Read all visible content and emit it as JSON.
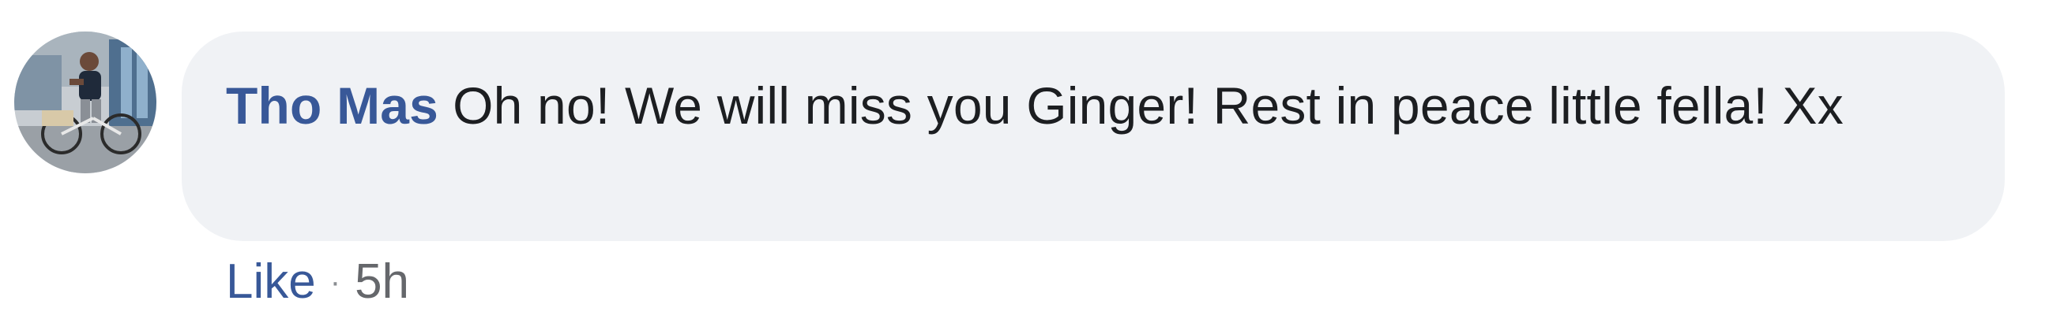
{
  "comment": {
    "author": "Tho Mas",
    "body": "Oh no! We will miss you Ginger! Rest in peace little fella! Xx",
    "like_label": "Like",
    "separator": "·",
    "timestamp": "5h"
  },
  "colors": {
    "bubble": "#f0f2f5",
    "author": "#385898",
    "text": "#1c1e21",
    "meta": "#65676b"
  }
}
